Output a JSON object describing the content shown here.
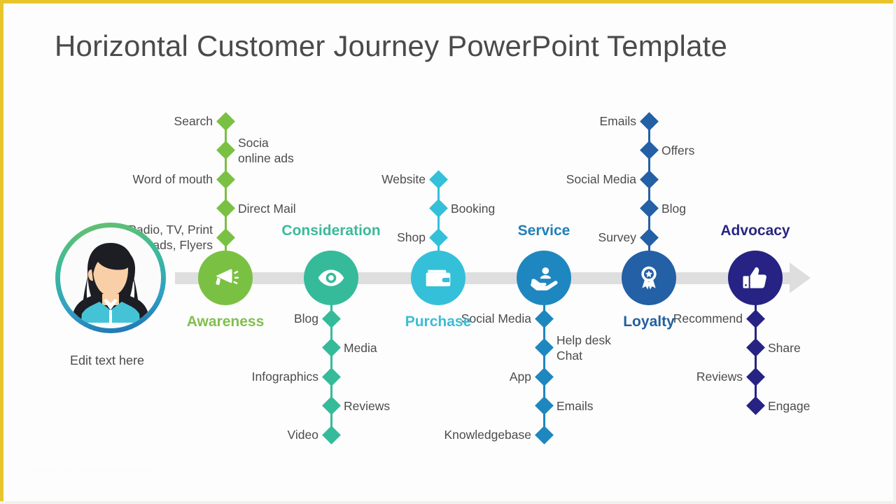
{
  "slide": {
    "title": "Horizontal Customer Journey PowerPoint Template",
    "watermark": "slidemodel.com | PowerPoint Templates",
    "background_color": "#fdfdfd",
    "frame_color": "#e8c52e",
    "timeline_color": "#dedede",
    "text_color": "#4c4c4c"
  },
  "persona": {
    "caption": "Edit text here",
    "icon": "female-avatar-icon",
    "ring_gradient_start": "#6cc067",
    "ring_gradient_end": "#1b6fb0",
    "hair_color": "#1d1d24",
    "skin_color": "#f8cfa6",
    "shirt_color": "#45c3d6"
  },
  "stages": [
    {
      "id": "awareness",
      "label": "Awareness",
      "icon": "megaphone-icon",
      "color": "#7ac143",
      "circle_color": "#7ac143",
      "label_color": "#82bf4e",
      "label_position": "below",
      "branch_direction": "up",
      "touchpoints": [
        {
          "text": "Radio, TV, Print\nads, Flyers",
          "side": "left"
        },
        {
          "text": "Direct Mail",
          "side": "right"
        },
        {
          "text": "Word of mouth",
          "side": "left"
        },
        {
          "text": "Socia\nonline ads",
          "side": "right"
        },
        {
          "text": "Search",
          "side": "left"
        }
      ]
    },
    {
      "id": "consideration",
      "label": "Consideration",
      "icon": "eye-icon",
      "color": "#35bb9a",
      "circle_color": "#35bb9a",
      "label_color": "#3cb99b",
      "label_position": "above",
      "branch_direction": "down",
      "touchpoints": [
        {
          "text": "Blog",
          "side": "left"
        },
        {
          "text": "Media",
          "side": "right"
        },
        {
          "text": "Infographics",
          "side": "left"
        },
        {
          "text": "Reviews",
          "side": "right"
        },
        {
          "text": "Video",
          "side": "left"
        }
      ]
    },
    {
      "id": "purchase",
      "label": "Purchase",
      "icon": "wallet-icon",
      "color": "#34c0d8",
      "circle_color": "#34c0d8",
      "label_color": "#3cbdd4",
      "label_position": "below",
      "branch_direction": "up",
      "touchpoints": [
        {
          "text": "Shop",
          "side": "left"
        },
        {
          "text": "Booking",
          "side": "right"
        },
        {
          "text": "Website",
          "side": "left"
        }
      ]
    },
    {
      "id": "service",
      "label": "Service",
      "icon": "service-hand-icon",
      "color": "#1f87c0",
      "circle_color": "#1f87c0",
      "label_color": "#2080b8",
      "label_position": "above",
      "branch_direction": "down",
      "touchpoints": [
        {
          "text": "Social Media",
          "side": "left"
        },
        {
          "text": "Help desk\nChat",
          "side": "right"
        },
        {
          "text": "App",
          "side": "left"
        },
        {
          "text": "Emails",
          "side": "right"
        },
        {
          "text": "Knowledgebase",
          "side": "left"
        }
      ]
    },
    {
      "id": "loyalty",
      "label": "Loyalty",
      "icon": "award-ribbon-icon",
      "color": "#2360a5",
      "circle_color": "#2360a5",
      "label_color": "#22609f",
      "label_position": "below",
      "branch_direction": "up",
      "touchpoints": [
        {
          "text": "Survey",
          "side": "left"
        },
        {
          "text": "Blog",
          "side": "right"
        },
        {
          "text": "Social Media",
          "side": "left"
        },
        {
          "text": "Offers",
          "side": "right"
        },
        {
          "text": "Emails",
          "side": "left"
        }
      ]
    },
    {
      "id": "advocacy",
      "label": "Advocacy",
      "icon": "thumbs-up-icon",
      "color": "#262384",
      "circle_color": "#262384",
      "label_color": "#282781",
      "label_position": "above",
      "branch_direction": "down",
      "touchpoints": [
        {
          "text": "Recommend",
          "side": "left"
        },
        {
          "text": "Share",
          "side": "right"
        },
        {
          "text": "Reviews",
          "side": "left"
        },
        {
          "text": "Engage",
          "side": "right"
        }
      ]
    }
  ]
}
